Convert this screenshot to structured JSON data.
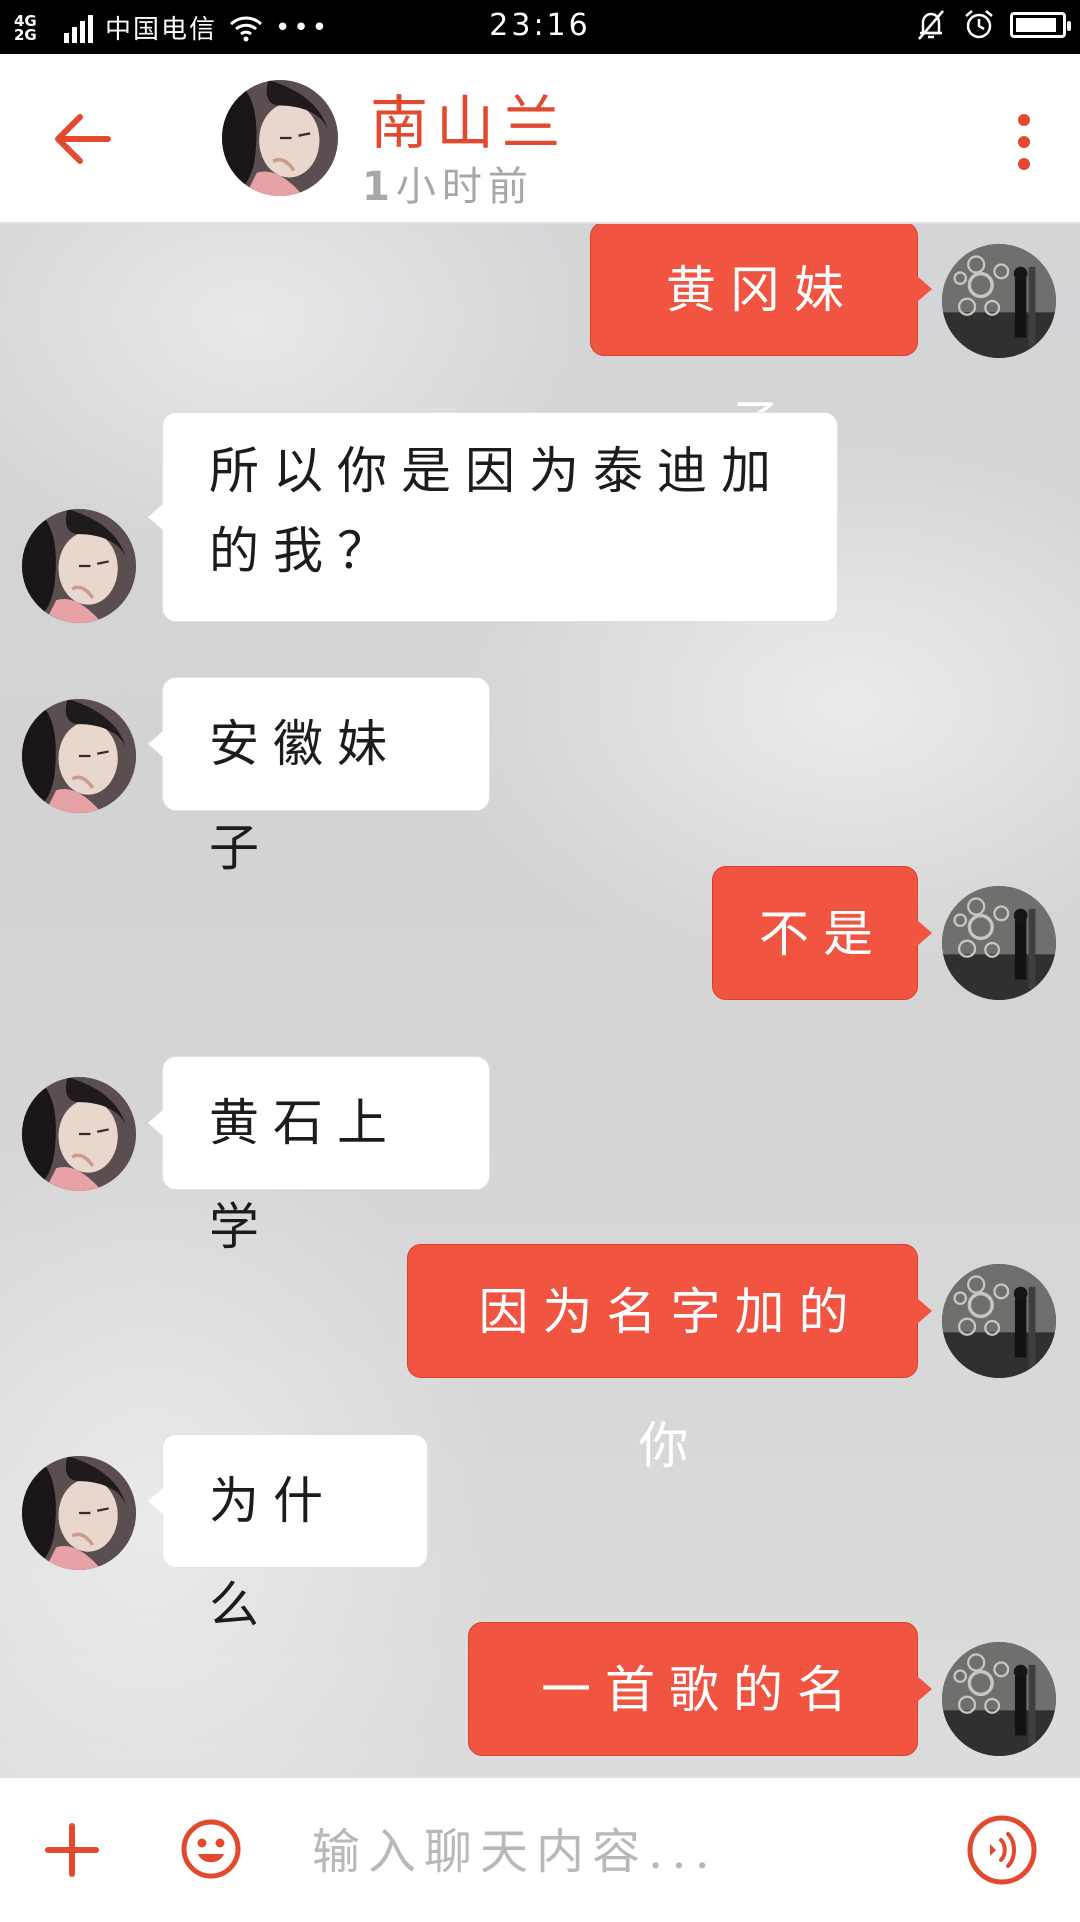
{
  "status_bar": {
    "network": "4G 2G",
    "carrier": "中国电信",
    "more": "•••",
    "time": "23:16",
    "battery_level": 0.92
  },
  "header": {
    "contact_name": "南山兰",
    "last_seen_num": "1",
    "last_seen_unit": "小时前"
  },
  "messages": [
    {
      "side": "out",
      "text": "黄冈妹子"
    },
    {
      "side": "in",
      "line1": "所以你是因为泰迪加",
      "line2": "的我？"
    },
    {
      "side": "in",
      "text": "安徽妹子"
    },
    {
      "side": "out",
      "text": "不是"
    },
    {
      "side": "in",
      "text": "黄石上学"
    },
    {
      "side": "out",
      "text": "因为名字加的你"
    },
    {
      "side": "in",
      "text": "为什么"
    },
    {
      "side": "out",
      "text": "一首歌的名字"
    }
  ],
  "input_bar": {
    "placeholder": "输入聊天内容..."
  },
  "colors": {
    "accent": "#e2492f",
    "outgoing_bubble": "#f15440",
    "incoming_bubble": "#ffffff"
  }
}
